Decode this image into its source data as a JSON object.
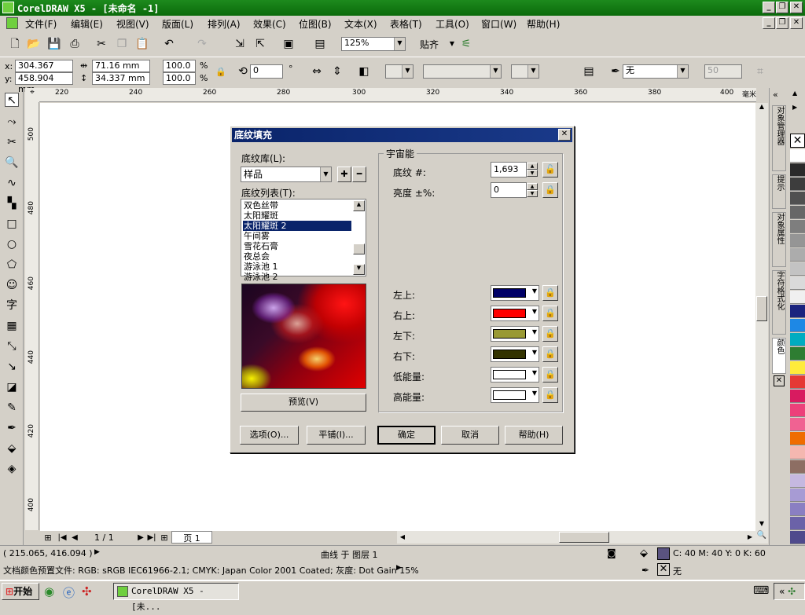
{
  "app": {
    "title": "CorelDRAW X5 - [未命名 -1]",
    "menu": [
      "文件(F)",
      "编辑(E)",
      "视图(V)",
      "版面(L)",
      "排列(A)",
      "效果(C)",
      "位图(B)",
      "文本(X)",
      "表格(T)",
      "工具(O)",
      "窗口(W)",
      "帮助(H)"
    ]
  },
  "toolbar": {
    "zoom": "125%",
    "snap_label": "贴齐"
  },
  "propbar": {
    "x": "304.367 mm",
    "y": "458.904 mm",
    "w": "71.16 mm",
    "h": "34.337 mm",
    "scale_x": "100.0",
    "scale_y": "100.0",
    "pct": "%",
    "rotate": "0",
    "deg": "°",
    "outline_none": "无",
    "num50": "50"
  },
  "ruler": {
    "top": [
      "220",
      "240",
      "260",
      "280",
      "300",
      "320",
      "340",
      "360",
      "380",
      "400"
    ],
    "unit": "毫米",
    "left": [
      "500",
      "480",
      "460",
      "440",
      "420",
      "400"
    ]
  },
  "dialog": {
    "title": "底纹填充",
    "library_label": "底纹库(L):",
    "library_value": "样品",
    "list_label": "底纹列表(T):",
    "list_items": [
      "双色丝带",
      "太阳耀斑",
      "太阳耀斑 2",
      "午间雾",
      "雪花石膏",
      "夜总会",
      "游泳池 1",
      "游泳池 2"
    ],
    "selected_index": 2,
    "preview_button": "预览(V)",
    "group_title": "宇宙能",
    "texture_label": "底纹 #:",
    "texture_value": "1,693",
    "brightness_label": "亮度 ±%:",
    "brightness_value": "0",
    "colors": [
      {
        "label": "左上:",
        "color": "#000066"
      },
      {
        "label": "右上:",
        "color": "#ff0000"
      },
      {
        "label": "左下:",
        "color": "#999933"
      },
      {
        "label": "右下:",
        "color": "#333300"
      },
      {
        "label": "低能量:",
        "color": "#ffffff"
      },
      {
        "label": "高能量:",
        "color": "#ffffff"
      }
    ],
    "buttons": {
      "options": "选项(O)...",
      "tile": "平铺(I)...",
      "ok": "确定",
      "cancel": "取消",
      "help": "帮助(H)"
    }
  },
  "pagebar": {
    "page_count": "1 / 1",
    "page_tab": "页 1"
  },
  "dockers": {
    "tabs": [
      "对象管理器",
      "提示",
      "对象属性",
      "字符格式化",
      "颜色"
    ]
  },
  "palette": [
    "#ffffff",
    "#2a2a2a",
    "#3d3d3d",
    "#505050",
    "#676767",
    "#7e7e7e",
    "#959595",
    "#acacac",
    "#c3c3c3",
    "#dadada",
    "#f0f0f0",
    "#1a237e",
    "#1e88e5",
    "#00acc1",
    "#2e7d32",
    "#ffeb3b",
    "#e53935",
    "#d81b60",
    "#ec407a",
    "#f06292",
    "#ef6c00",
    "#f4b7b0",
    "#8d6e63",
    "#c5b8e0",
    "#a79bd4",
    "#8a7fc2",
    "#6b62a8",
    "#4f4a8c"
  ],
  "status": {
    "coords": "( 215.065, 416.094 )",
    "layer": "曲线 于 图层 1",
    "fill_text": "C: 40 M: 40 Y: 0 K: 60",
    "fill_swatch": "#5a5380",
    "outline_text": "无",
    "color_profile": "文档颜色预置文件: RGB: sRGB IEC61966-2.1; CMYK: Japan Color 2001 Coated; 灰度: Dot Gain 15%"
  },
  "taskbar": {
    "start": "开始",
    "task": "CorelDRAW X5 - [未..."
  }
}
